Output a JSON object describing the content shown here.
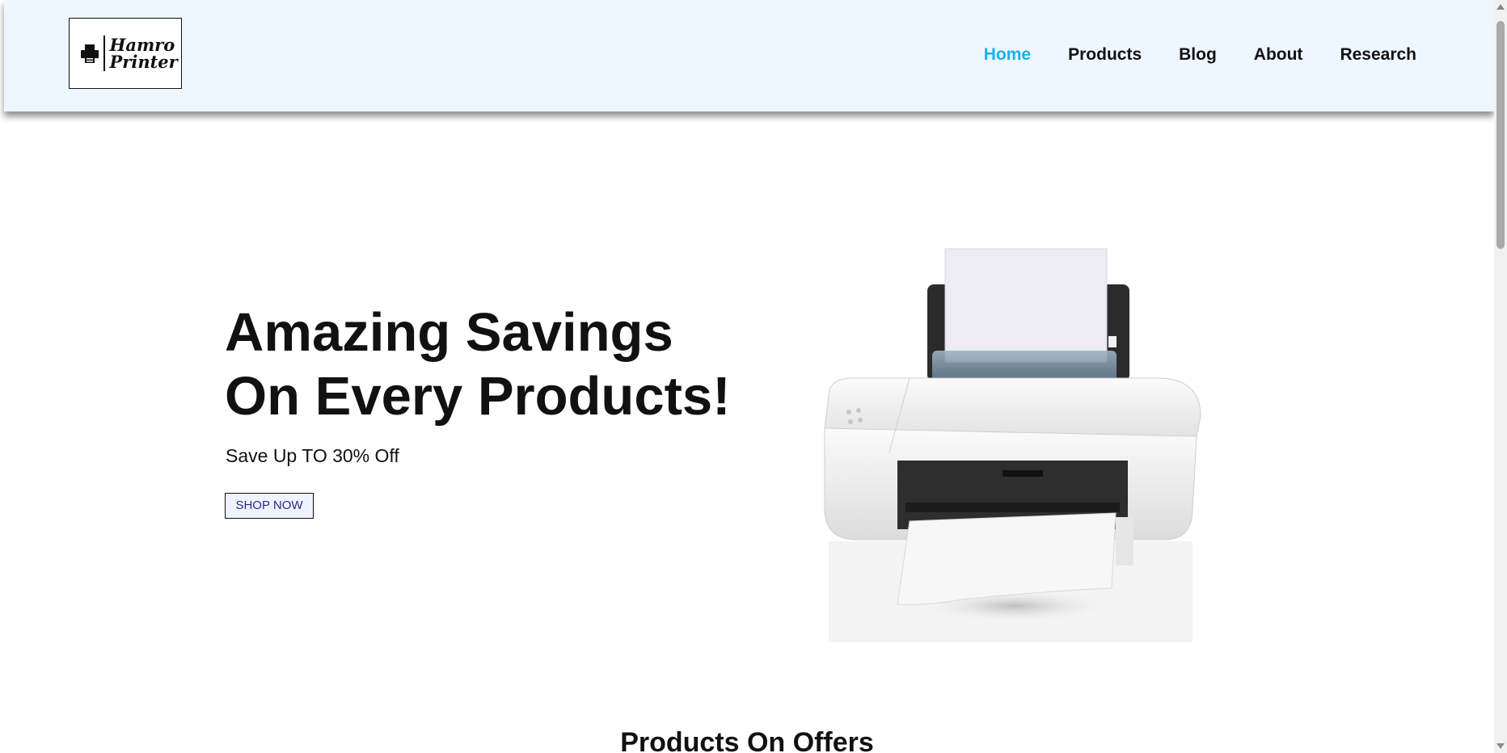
{
  "header": {
    "logo": {
      "line1": "Hamro",
      "line2": "Printer",
      "icon": "printer-icon"
    },
    "nav": [
      {
        "label": "Home",
        "active": true
      },
      {
        "label": "Products",
        "active": false
      },
      {
        "label": "Blog",
        "active": false
      },
      {
        "label": "About",
        "active": false
      },
      {
        "label": "Research",
        "active": false
      }
    ]
  },
  "hero": {
    "title_line1": "Amazing Savings",
    "title_line2": "On Every Products!",
    "subtitle": "Save Up TO 30% Off",
    "cta_label": "SHOP NOW",
    "image": "printer-product-image"
  },
  "next_section": {
    "title": "Products On Offers"
  },
  "colors": {
    "header_bg": "#eef6ff",
    "nav_active": "#17b3ea",
    "text": "#111111",
    "cta_bg": "#eef3ff",
    "cta_text": "#2a2a8a"
  }
}
